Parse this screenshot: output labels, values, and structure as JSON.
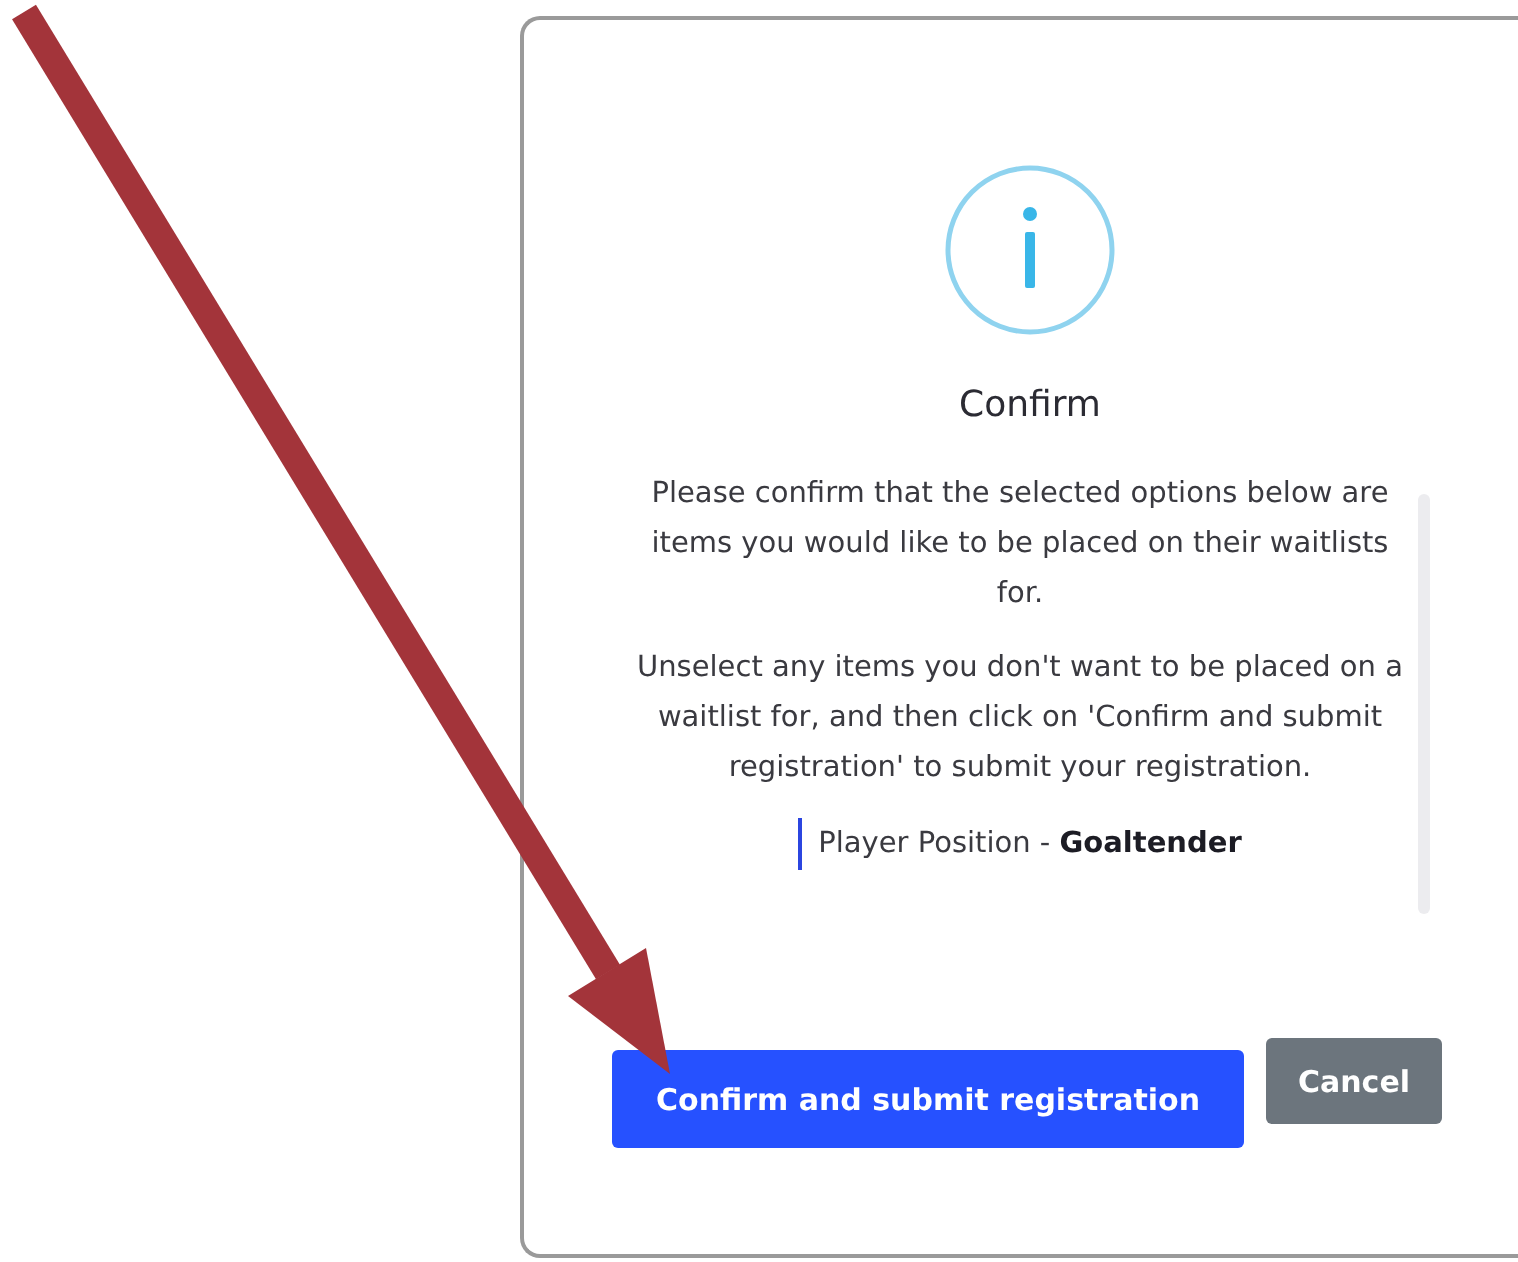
{
  "dialog": {
    "title": "Confirm",
    "paragraphs": [
      "Please confirm that the selected options below are items you would like to be placed on their waitlists for.",
      "Unselect any items you don't want to be placed on a waitlist for, and then click on 'Confirm and submit registration' to submit your registration."
    ],
    "items": [
      "Player Position - **Goaltender**"
    ],
    "buttons": [
      {
        "label": "Confirm and submit registration",
        "kind": "primary"
      },
      {
        "label": "Cancel",
        "kind": "secondary"
      }
    ]
  }
}
